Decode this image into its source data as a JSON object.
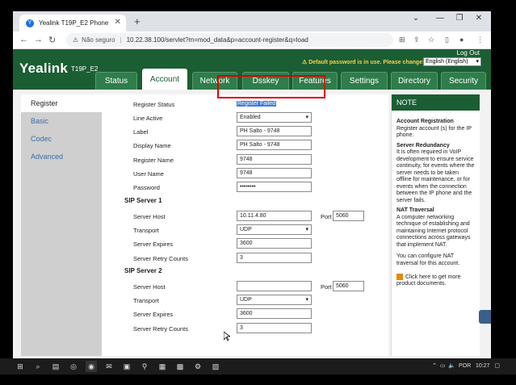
{
  "browser": {
    "tab_title": "Yealink T19P_E2 Phone",
    "tab_favicon": "Y",
    "new_tab": "+",
    "address_security": "Não seguro",
    "address_url": "10.22.38.100/servlet?m=mod_data&p=account-register&q=load",
    "icons": [
      "back-icon",
      "forward-icon",
      "reload-icon",
      "translate-icon",
      "share-icon",
      "bookmark-icon",
      "sidepanel-icon",
      "profile-icon",
      "menu-icon"
    ]
  },
  "header": {
    "logo": "Yealink",
    "model": "T19P_E2",
    "logout": "Log Out",
    "default_password_warning": "Default password is in use. Please change!",
    "language": "English (English)",
    "tabs": [
      {
        "label": "Status"
      },
      {
        "label": "Account"
      },
      {
        "label": "Network"
      },
      {
        "label": "Dsskey"
      },
      {
        "label": "Features"
      },
      {
        "label": "Settings"
      },
      {
        "label": "Directory"
      },
      {
        "label": "Security"
      }
    ],
    "active_tab": "Account"
  },
  "left_menu": [
    {
      "label": "Register"
    },
    {
      "label": "Basic"
    },
    {
      "label": "Codec"
    },
    {
      "label": "Advanced"
    }
  ],
  "form": {
    "register_status_label": "Register Status",
    "register_status_value": "Register Failed",
    "line_active_label": "Line Active",
    "line_active_value": "Enabled",
    "label_label": "Label",
    "label_value": "PH Salto - 9748",
    "display_name_label": "Display Name",
    "display_name_value": "PH Salto - 9748",
    "register_name_label": "Register Name",
    "register_name_value": "9748",
    "user_name_label": "User Name",
    "user_name_value": "9748",
    "password_label": "Password",
    "password_value": "••••••••",
    "sip1_title": "SIP Server 1",
    "sip1_host_label": "Server Host",
    "sip1_host_value": "10.11.4.80",
    "sip1_port_label": "Port",
    "sip1_port_value": "5060",
    "sip1_transport_label": "Transport",
    "sip1_transport_value": "UDP",
    "sip1_expires_label": "Server Expires",
    "sip1_expires_value": "3600",
    "sip1_retry_label": "Server Retry Counts",
    "sip1_retry_value": "3",
    "sip2_title": "SIP Server 2",
    "sip2_host_label": "Server Host",
    "sip2_host_value": "",
    "sip2_port_label": "Port",
    "sip2_port_value": "5060",
    "sip2_transport_label": "Transport",
    "sip2_transport_value": "UDP",
    "sip2_expires_label": "Server Expires",
    "sip2_expires_value": "3600",
    "sip2_retry_label": "Server Retry Counts",
    "sip2_retry_value": "3"
  },
  "note": {
    "title": "NOTE",
    "h1": "Account Registration",
    "p1": "Register account (s) for the IP phone.",
    "h2": "Server Redundancy",
    "p2": "It is often required in VoIP development to ensure service continuity, for events where the server needs to be taken offline for maintenance, or for events when the connection between the IP phone and the server fails.",
    "h3": "NAT Traversal",
    "p3": "A computer networking technique of establishing and maintaining Internet protocol connections across gateways that implement NAT.",
    "p4": "You can configure NAT traversal for this account.",
    "more": "Click here to get more product documents."
  },
  "taskbar": {
    "language": "POR",
    "time": "10:27"
  },
  "colors": {
    "brand_green": "#1b5e33",
    "highlight_red": "#e00000",
    "status_selection": "#3f7fd3"
  }
}
